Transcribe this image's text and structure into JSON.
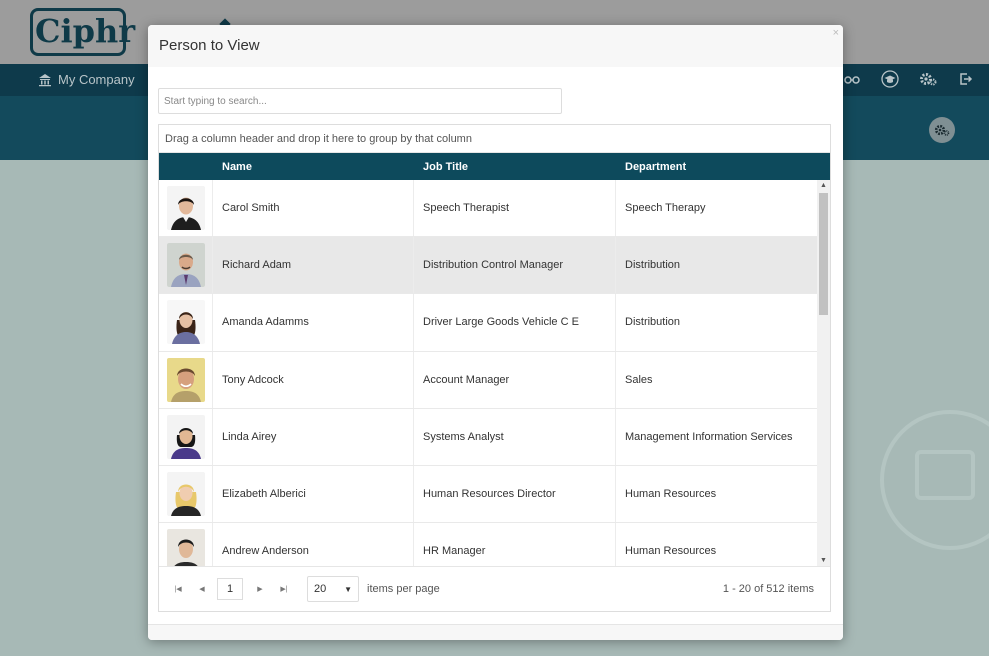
{
  "app": {
    "logo_text": "Ciphr",
    "nav_item_label": "My Company"
  },
  "modal": {
    "title": "Person to View",
    "close_label": "×",
    "search_placeholder": "Start typing to search...",
    "group_hint": "Drag a column header and drop it here to group by that column",
    "columns": {
      "name": "Name",
      "job_title": "Job Title",
      "department": "Department"
    },
    "rows": [
      {
        "name": "Carol Smith",
        "job_title": "Speech Therapist",
        "department": "Speech Therapy"
      },
      {
        "name": "Richard Adam",
        "job_title": "Distribution Control Manager",
        "department": "Distribution"
      },
      {
        "name": "Amanda Adamms",
        "job_title": "Driver Large Goods Vehicle C E",
        "department": "Distribution"
      },
      {
        "name": "Tony Adcock",
        "job_title": "Account Manager",
        "department": "Sales"
      },
      {
        "name": "Linda Airey",
        "job_title": "Systems Analyst",
        "department": "Management Information Services"
      },
      {
        "name": "Elizabeth Alberici",
        "job_title": "Human Resources Director",
        "department": "Human Resources"
      },
      {
        "name": "Andrew Anderson",
        "job_title": "HR Manager",
        "department": "Human Resources"
      }
    ],
    "pager": {
      "current_page": "1",
      "page_size": "20",
      "items_per_page_label": "items per page",
      "info": "1 - 20 of 512 items"
    }
  },
  "colors": {
    "nav": "#0e3a4b",
    "grid_header": "#0d4a5c",
    "selected_row": "#e8e8e8"
  }
}
